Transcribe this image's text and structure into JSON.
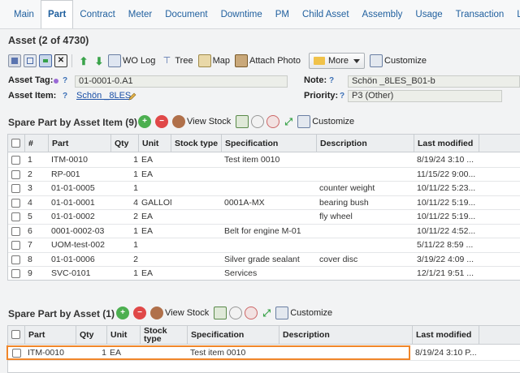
{
  "tabs": [
    "Main",
    "Part",
    "Contract",
    "Meter",
    "Document",
    "Downtime",
    "PM",
    "Child Asset",
    "Assembly",
    "Usage",
    "Transaction",
    "Linear"
  ],
  "active_tab": "Part",
  "page_title": "Asset (2 of 4730)",
  "toolbar": {
    "wo_log": "WO Log",
    "tree": "Tree",
    "map": "Map",
    "attach_photo": "Attach Photo",
    "more": "More",
    "customize": "Customize"
  },
  "form": {
    "asset_tag_label": "Asset Tag:",
    "asset_tag_help": "?",
    "asset_tag_value": "01-0001-0.A1",
    "asset_item_label": "Asset Item:",
    "asset_item_help": "?",
    "asset_item_value": "Schön _8LES",
    "note_label": "Note:",
    "note_help": "?",
    "note_value": "Schön _8LES_B01-b",
    "priority_label": "Priority:",
    "priority_help": "?",
    "priority_value": "P3 (Other)"
  },
  "spare_by_item": {
    "title": "Spare Part by Asset Item (9)",
    "view_stock": "View Stock",
    "customize": "Customize",
    "columns": [
      "#",
      "Part",
      "Qty",
      "Unit",
      "Stock type",
      "Specification",
      "Description",
      "Last modified"
    ],
    "rows": [
      {
        "n": "1",
        "part": "ITM-0010",
        "qty": "1",
        "unit": "EA",
        "stock": "",
        "spec": "Test item 0010",
        "desc": "",
        "modified": "8/19/24 3:10 ..."
      },
      {
        "n": "2",
        "part": "RP-001",
        "qty": "1",
        "unit": "EA",
        "stock": "",
        "spec": "",
        "desc": "",
        "modified": "11/15/22 9:00..."
      },
      {
        "n": "3",
        "part": "01-01-0005",
        "qty": "1",
        "unit": "",
        "stock": "",
        "spec": "",
        "desc": "counter weight",
        "modified": "10/11/22 5:23..."
      },
      {
        "n": "4",
        "part": "01-01-0001",
        "qty": "4",
        "unit": "GALLON",
        "stock": "",
        "spec": "0001A-MX",
        "desc": "bearing bush",
        "modified": "10/11/22 5:19..."
      },
      {
        "n": "5",
        "part": "01-01-0002",
        "qty": "2",
        "unit": "EA",
        "stock": "",
        "spec": "",
        "desc": "fly wheel",
        "modified": "10/11/22 5:19..."
      },
      {
        "n": "6",
        "part": "0001-0002-03",
        "qty": "1",
        "unit": "EA",
        "stock": "",
        "spec": "Belt for engine M-01",
        "desc": "",
        "modified": "10/11/22 4:52..."
      },
      {
        "n": "7",
        "part": "UOM-test-002",
        "qty": "1",
        "unit": "",
        "stock": "",
        "spec": "",
        "desc": "",
        "modified": "5/11/22 8:59 ..."
      },
      {
        "n": "8",
        "part": "01-01-0006",
        "qty": "2",
        "unit": "",
        "stock": "",
        "spec": "Silver grade sealant",
        "desc": "cover disc",
        "modified": "3/19/22 4:09 ..."
      },
      {
        "n": "9",
        "part": "SVC-0101",
        "qty": "1",
        "unit": "EA",
        "stock": "",
        "spec": "Services",
        "desc": "",
        "modified": "12/1/21 9:51 ..."
      }
    ]
  },
  "spare_by_asset": {
    "title": "Spare Part by Asset (1)",
    "view_stock": "View Stock",
    "customize": "Customize",
    "columns": [
      "Part",
      "Qty",
      "Unit",
      "Stock type",
      "Specification",
      "Description",
      "Last modified"
    ],
    "rows": [
      {
        "part": "ITM-0010",
        "qty": "1",
        "unit": "EA",
        "stock": "",
        "spec": "Test item 0010",
        "desc": "",
        "modified": "8/19/24 3:10 P..."
      }
    ]
  },
  "colors": {
    "accent": "#1f5f9e",
    "selection": "#f0862a",
    "add": "#4caf50",
    "remove": "#e04848"
  }
}
